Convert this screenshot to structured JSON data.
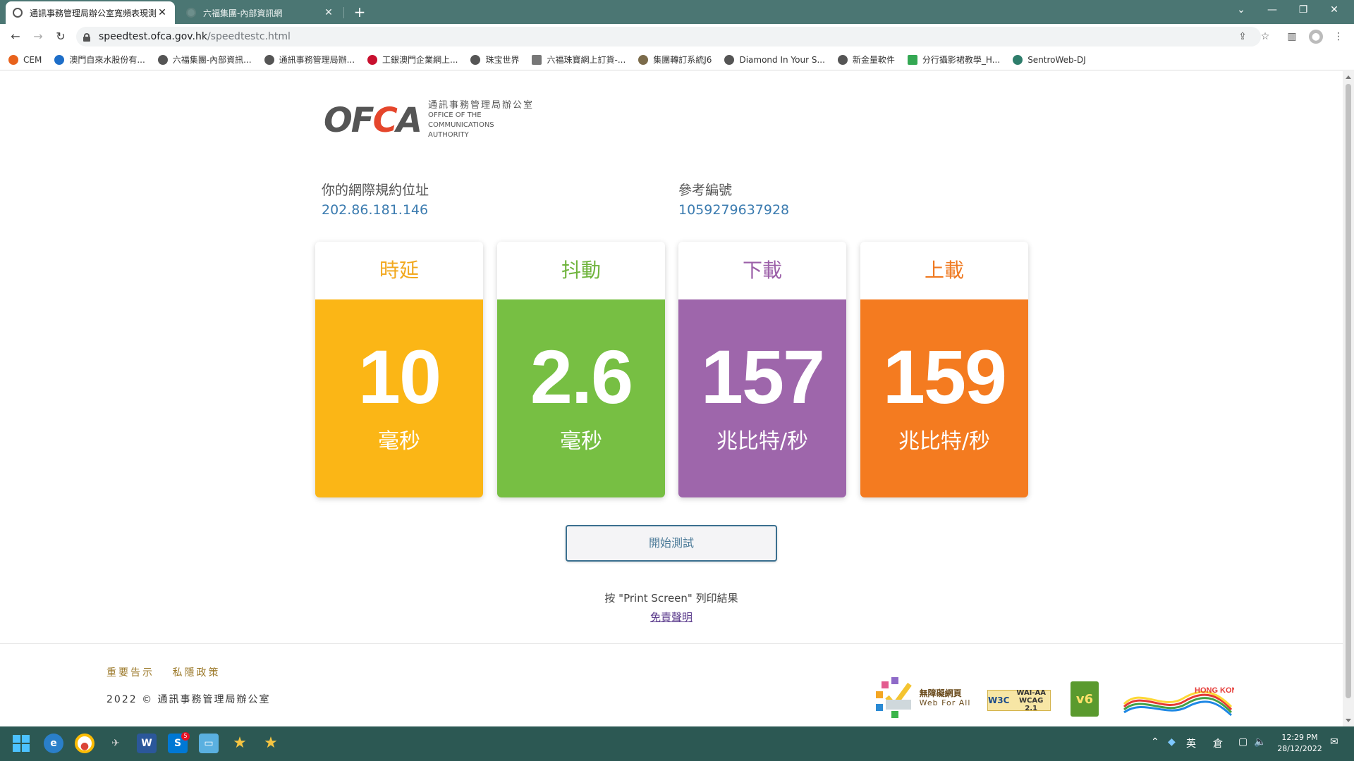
{
  "browser": {
    "tabs": [
      {
        "title": "通訊事務管理局辦公室寬頻表現測",
        "active": true
      },
      {
        "title": "六福集團-內部資訊網",
        "active": false
      }
    ],
    "url_host": "speedtest.ofca.gov.hk",
    "url_path": "/speedtestc.html",
    "bookmarks": [
      {
        "label": "CEM",
        "color": "#e8621c",
        "icon": "cem-icon"
      },
      {
        "label": "澳門自來水股份有...",
        "color": "#1e6ec8",
        "icon": "water-icon"
      },
      {
        "label": "六福集團-內部資訊...",
        "color": "#555555",
        "icon": "globe-icon"
      },
      {
        "label": "通訊事務管理局辦...",
        "color": "#555555",
        "icon": "globe-icon"
      },
      {
        "label": "工銀澳門企業網上...",
        "color": "#c8102e",
        "icon": "icbc-icon"
      },
      {
        "label": "珠宝世界",
        "color": "#555555",
        "icon": "globe-icon"
      },
      {
        "label": "六福珠寶網上訂貨-...",
        "color": "#555555",
        "icon": "lf-icon"
      },
      {
        "label": "集團轉訂系統J6",
        "color": "#7b6b4b",
        "icon": "gear-icon"
      },
      {
        "label": "Diamond In Your S...",
        "color": "#555555",
        "icon": "globe-icon"
      },
      {
        "label": "新金量軟件",
        "color": "#555555",
        "icon": "globe-icon"
      },
      {
        "label": "分行攝影裙教學_H...",
        "color": "#34a853",
        "icon": "drive-icon"
      },
      {
        "label": "SentroWeb-DJ",
        "color": "#2e7d6b",
        "icon": "sw-icon"
      }
    ]
  },
  "logo": {
    "zh": "通訊事務管理局辦公室",
    "en_line1": "OFFICE OF THE",
    "en_line2": "COMMUNICATIONS AUTHORITY"
  },
  "info": {
    "ip_label": "你的網際規約位址",
    "ip_value": "202.86.181.146",
    "ref_label": "參考編號",
    "ref_value": "1059279637928"
  },
  "cards": [
    {
      "title": "時延",
      "value": "10",
      "unit": "毫秒",
      "color": "#fbb616",
      "title_color": "#f2a81d"
    },
    {
      "title": "抖動",
      "value": "2.6",
      "unit": "毫秒",
      "color": "#77bf43",
      "title_color": "#6fb43c"
    },
    {
      "title": "下載",
      "value": "157",
      "unit": "兆比特/秒",
      "color": "#9e66ab",
      "title_color": "#9b5fa8"
    },
    {
      "title": "上載",
      "value": "159",
      "unit": "兆比特/秒",
      "color": "#f47b20",
      "title_color": "#ef7a22"
    }
  ],
  "actions": {
    "start_label": "開始測試",
    "print_note": "按 \"Print Screen\" 列印結果",
    "disclaimer": "免責聲明"
  },
  "footer": {
    "link_notice": "重要告示",
    "link_privacy": "私隱政策",
    "copyright": "2022 © 通訊事務管理局辦公室",
    "webforall_zh": "無障礙網頁",
    "webforall_en": "Web For All",
    "w3c_line1": "WAI-AA",
    "w3c_line2": "WCAG 2.1",
    "hk_label": "HONG KONG"
  },
  "taskbar": {
    "time": "12:29 PM",
    "date": "28/12/2022",
    "lang": "英",
    "ime": "倉",
    "notify_count": "5"
  }
}
